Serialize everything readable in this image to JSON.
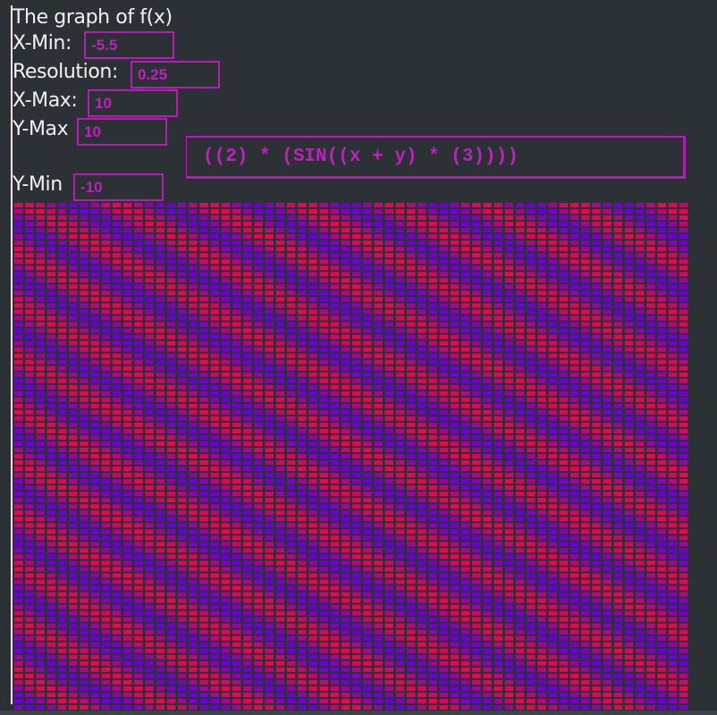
{
  "page": {
    "title": "The graph of f(x)"
  },
  "inputs": {
    "xmin": {
      "label": "X-Min:",
      "value": "-5.5"
    },
    "resolution": {
      "label": "Resolution:",
      "value": "0.25"
    },
    "xmax": {
      "label": "X-Max:",
      "value": "10"
    },
    "ymax": {
      "label": "Y-Max",
      "value": "10"
    },
    "ymin": {
      "label": "Y-Min",
      "value": "-10"
    },
    "formula": {
      "value": "((2) * (SIN((x + y) * (3))))"
    }
  },
  "graph": {
    "function": "2*sin((x+y)*3)",
    "columns": 62,
    "rows": 81,
    "color_low": "#6a00d8",
    "color_high": "#e8094c"
  },
  "colors": {
    "background": "#2b3134",
    "accent": "#b51bb5",
    "input_text": "#c11fc1",
    "label_text": "#f1f1f1"
  }
}
